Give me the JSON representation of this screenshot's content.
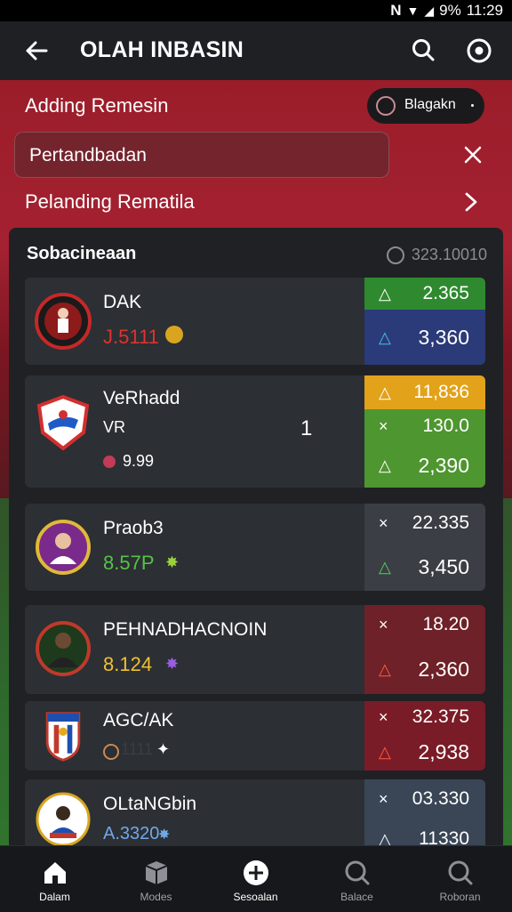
{
  "status": {
    "network": "N",
    "battery": "9%",
    "time": "11:29"
  },
  "appbar": {
    "title": "OLAH INBASIN"
  },
  "header": {
    "section_title": "Adding Remesin",
    "pill_label": "Blagakn",
    "search_value": "Pertandbadan",
    "link_label": "Pelanding Rematila"
  },
  "panel": {
    "title": "Sobacineaan",
    "meta": "323.10010"
  },
  "cards": [
    {
      "name": "DAK",
      "sub": "J.5111",
      "sub_color": "#e0322e",
      "center": "",
      "odds": [
        {
          "sym": "△",
          "val": "2.365",
          "bg": "#2f8a2f"
        },
        {
          "sym": "△",
          "val": "3,360",
          "bg": "#2b3a78"
        }
      ]
    },
    {
      "name": "VeRhadd",
      "name2": "VR",
      "sub": "9.99",
      "sub_color": "#ffffff",
      "center": "1",
      "odds": [
        {
          "sym": "△",
          "val": "11,836",
          "bg": "#e2a21a"
        },
        {
          "sym": "×",
          "val": "130.0",
          "bg": "#4e9630"
        },
        {
          "sym": "△",
          "val": "2,390",
          "bg": "#4e9630"
        }
      ]
    },
    {
      "name": "Praob3",
      "sub": "8.57P",
      "sub_color": "#56c247",
      "center": "",
      "odds": [
        {
          "sym": "×",
          "val": "22.335",
          "bg": "#3b3e45"
        },
        {
          "sym": "△",
          "val": "3,450",
          "bg": "#3b3e45"
        }
      ]
    },
    {
      "name": "PEHNADHACNOIN",
      "sub": "8.124",
      "sub_color": "#f2c12e",
      "center": "",
      "odds": [
        {
          "sym": "×",
          "val": "18.20",
          "bg": "#6e2128"
        },
        {
          "sym": "△",
          "val": "2,360",
          "bg": "#6e2128"
        }
      ]
    },
    {
      "name": "AGC/AK",
      "sub": "1111",
      "sub_color": "#3a3d44",
      "center": "",
      "odds": [
        {
          "sym": "×",
          "val": "32.375",
          "bg": "#7a1c27"
        },
        {
          "sym": "△",
          "val": "2,938",
          "bg": "#7a1c27"
        }
      ]
    },
    {
      "name": "OLtaNGbin",
      "sub": "A.3320",
      "sub_color": "#6fa8e8",
      "center": "",
      "odds": [
        {
          "sym": "×",
          "val": "03.330",
          "bg": "#3a4656"
        },
        {
          "sym": "△",
          "val": "11330",
          "bg": "#3a4656"
        }
      ]
    }
  ],
  "nav": [
    {
      "label": "Dalam",
      "icon": "home-icon"
    },
    {
      "label": "Modes",
      "icon": "box-icon"
    },
    {
      "label": "Sesoalan",
      "icon": "plus-circle-icon"
    },
    {
      "label": "Balace",
      "icon": "search-icon"
    },
    {
      "label": "Roboran",
      "icon": "search-icon"
    }
  ],
  "colors": {
    "accent_red": "#a42131",
    "panel": "#1f2125",
    "card": "#2c2f34"
  }
}
